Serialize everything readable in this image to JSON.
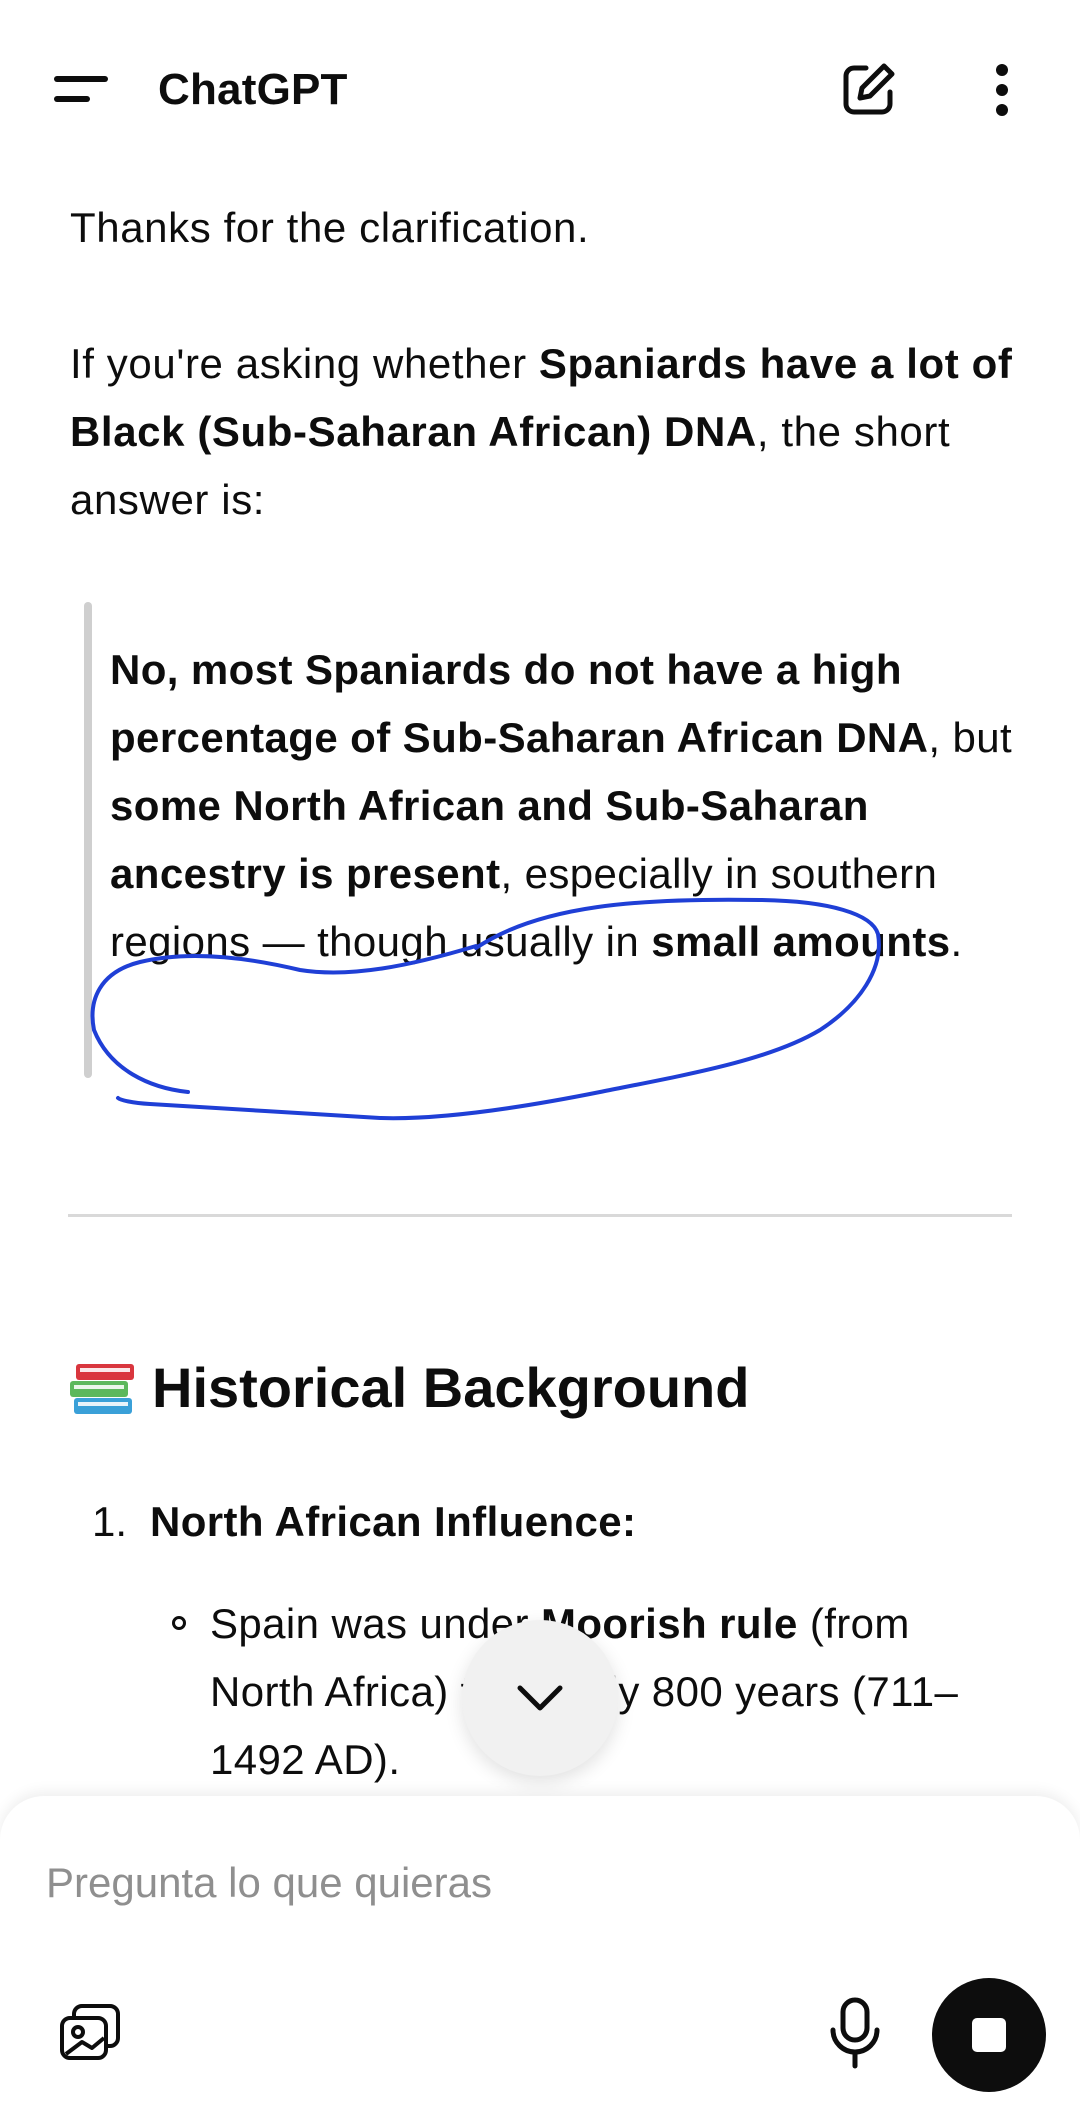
{
  "header": {
    "title": "ChatGPT",
    "menu_icon": "menu-icon",
    "new_chat_icon": "new-chat-icon",
    "more_icon": "more-vertical-icon"
  },
  "message": {
    "p1": "Thanks for the clarification.",
    "p2": {
      "t1": "If you're asking whether ",
      "b1": "Spaniards have a lot of Black (Sub-Saharan African) DNA",
      "t2": ", the short answer is:"
    },
    "quote": {
      "b1": "No, most Spaniards do not have a high percentage of Sub-Saharan African DNA",
      "t1": ", but ",
      "b2": "some North African and Sub-Saharan ancestry is present",
      "t2": ", especially in southern regions — though usually in ",
      "b3": "small amounts",
      "t3": "."
    },
    "section_title": "Historical Background",
    "section_emoji": "books-emoji",
    "list": [
      {
        "number": "1.",
        "title": "North African Influence:",
        "sub": {
          "t1": "Spain was under ",
          "b1": "Moorish rule",
          "t2": " (from North Africa) for nearly 800 years (711–1492 AD)."
        }
      }
    ]
  },
  "annotation": {
    "color": "#1f3fd6",
    "shape": "hand-drawn-circle"
  },
  "scroll_button": {
    "icon": "chevron-down-icon"
  },
  "composer": {
    "placeholder": "Pregunta lo que quieras",
    "attach_icon": "image-attach-icon",
    "mic_icon": "mic-icon",
    "stop_icon": "stop-icon"
  }
}
